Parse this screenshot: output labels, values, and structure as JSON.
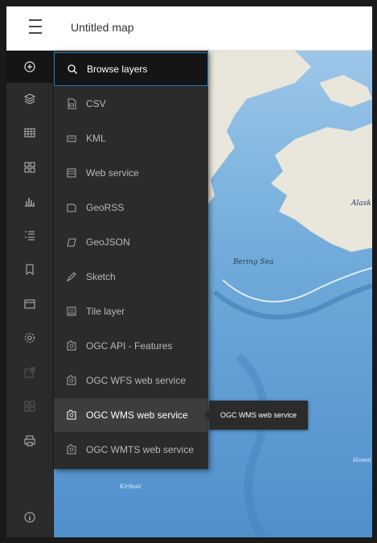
{
  "header": {
    "title": "Untitled map"
  },
  "rail": {
    "items": [
      {
        "icon": "add-layer-icon"
      },
      {
        "icon": "layers-icon"
      },
      {
        "icon": "table-icon"
      },
      {
        "icon": "legend-icon"
      },
      {
        "icon": "charts-icon"
      },
      {
        "icon": "list-icon"
      },
      {
        "icon": "bookmark-icon"
      },
      {
        "icon": "basemap-icon"
      },
      {
        "icon": "settings-icon"
      },
      {
        "icon": "share-icon"
      },
      {
        "icon": "grid-icon"
      },
      {
        "icon": "print-icon"
      },
      {
        "icon": "info-icon"
      }
    ]
  },
  "menu": {
    "items": [
      {
        "label": "Browse layers",
        "icon": "search-icon"
      },
      {
        "label": "CSV",
        "icon": "csv-file-icon"
      },
      {
        "label": "KML",
        "icon": "kml-file-icon"
      },
      {
        "label": "Web service",
        "icon": "web-service-icon"
      },
      {
        "label": "GeoRSS",
        "icon": "georss-icon"
      },
      {
        "label": "GeoJSON",
        "icon": "geojson-icon"
      },
      {
        "label": "Sketch",
        "icon": "sketch-icon"
      },
      {
        "label": "Tile layer",
        "icon": "tile-layer-icon"
      },
      {
        "label": "OGC API - Features",
        "icon": "ogc-icon"
      },
      {
        "label": "OGC WFS web service",
        "icon": "ogc-icon"
      },
      {
        "label": "OGC WMS web service",
        "icon": "ogc-icon"
      },
      {
        "label": "OGC WMTS web service",
        "icon": "ogc-icon"
      }
    ]
  },
  "tooltip": {
    "text": "OGC WMS web service"
  },
  "map": {
    "labels": {
      "sea": "Bering Sea",
      "alaska": "Alask",
      "kiribati": "Kiribati",
      "hawaii": "Hawai"
    }
  },
  "colors": {
    "accent": "#1d7bbf",
    "panel": "#2b2b2b",
    "ocean": "#6ea9d9",
    "land": "#e9e6dc"
  }
}
